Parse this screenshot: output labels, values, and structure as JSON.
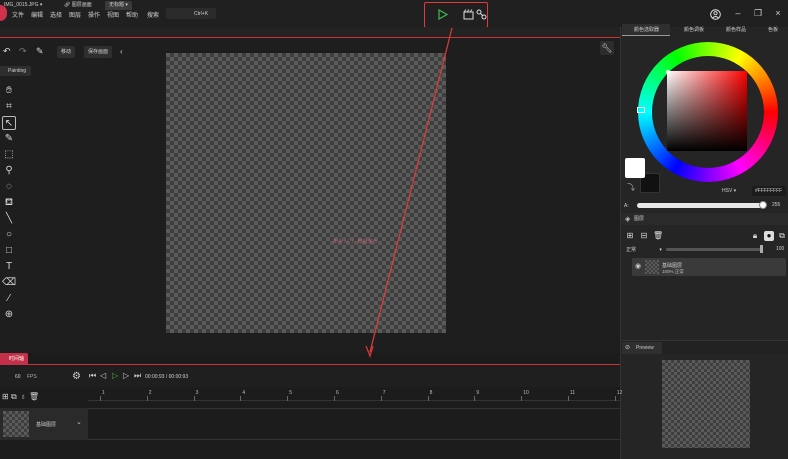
{
  "titlebar": {
    "menus": [
      "文件",
      "编辑",
      "选择",
      "图层",
      "操作",
      "视图",
      "帮助",
      "搜索"
    ],
    "search_shortcut": "Ctrl+K"
  },
  "tabs": [
    {
      "label": "IMG_0015.JPG"
    },
    {
      "label": "图层画面"
    },
    {
      "label": "无标题"
    }
  ],
  "toolbar": {
    "move_label": "移动",
    "save_label": "保存画面"
  },
  "left_tools": {
    "panel_label": "Painting"
  },
  "watermark": "新手入门 · 教程演示",
  "right_panel": {
    "tabs": [
      "颜色选取器",
      "颜色调板",
      "颜色样品",
      "色板"
    ],
    "mode": "HSV",
    "hex_value": "#FFFFFFFF",
    "alpha_label": "A:",
    "alpha_value": "255",
    "primary_color": "#ffffff",
    "secondary_color": "#111111",
    "accent_color": "#e23a3a"
  },
  "layers": {
    "title": "图层",
    "blend_mode": "正常",
    "opacity": "100",
    "items": [
      {
        "name": "基础图层",
        "meta": "100% 正常"
      }
    ]
  },
  "preview": {
    "title": "Preview"
  },
  "timeline": {
    "tab_label": "时间轴",
    "fps_value": "60",
    "fps_label": "FPS",
    "timecode": "00:00:93 / 00:00:93",
    "ruler": [
      "1",
      "2",
      "3",
      "4",
      "5",
      "6",
      "7",
      "8",
      "9",
      "10",
      "11",
      "12"
    ],
    "track_name": "基础图层"
  }
}
